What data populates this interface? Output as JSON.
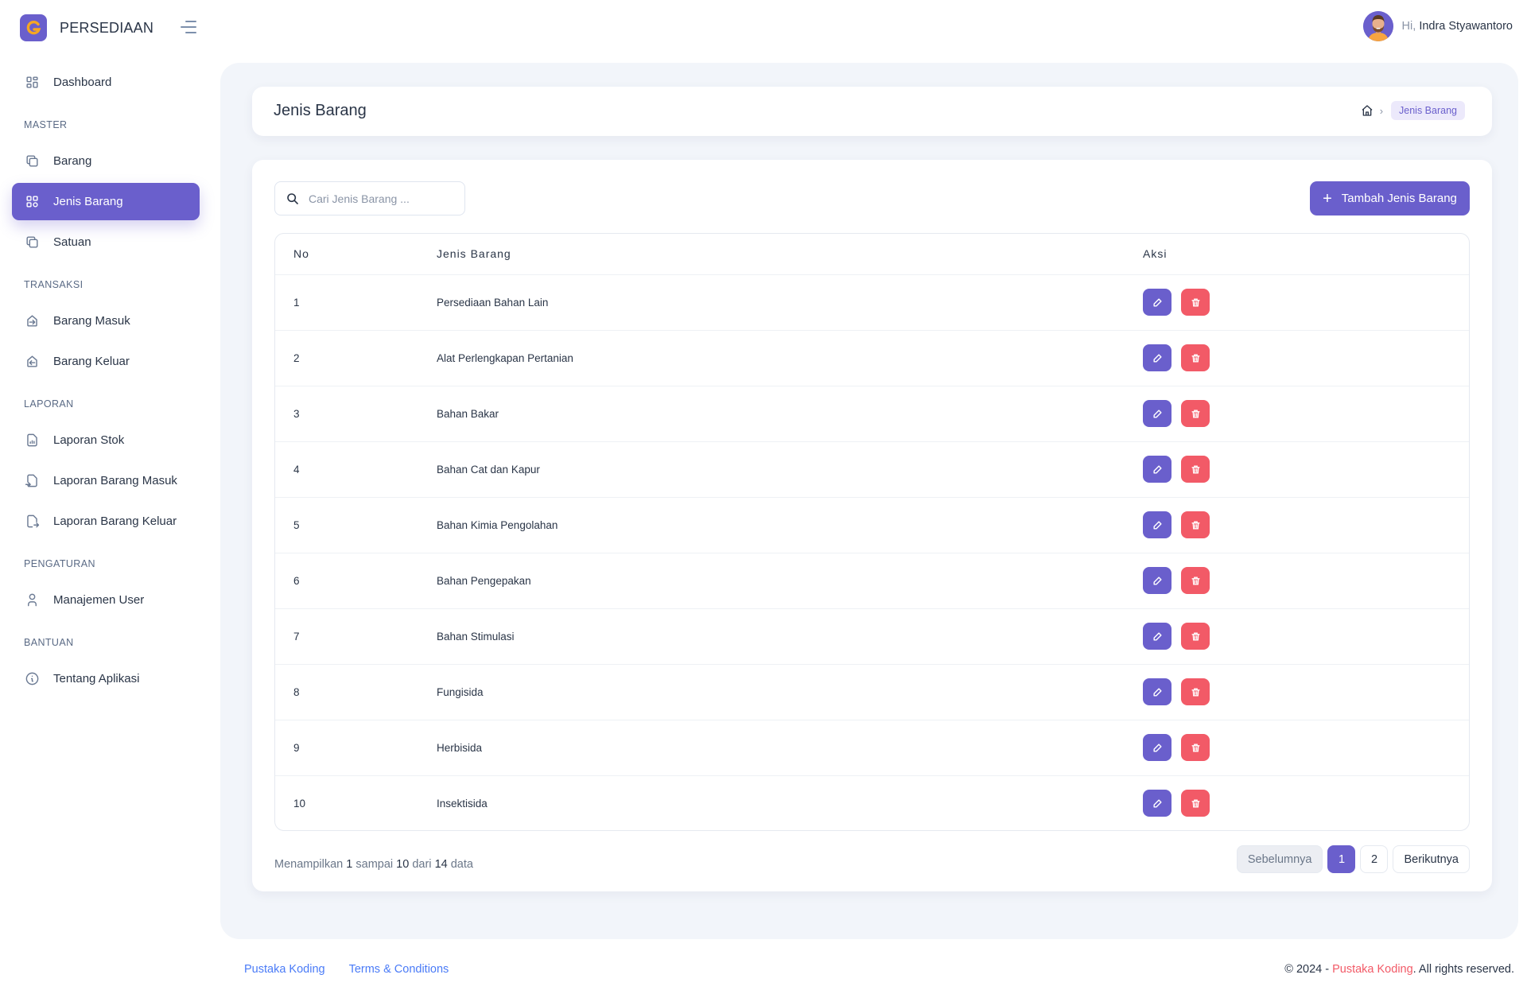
{
  "brand": {
    "logo_letter": "G",
    "name": "PERSEDIAAN",
    "accent": "#6a5fcc",
    "logo_letter_color": "#f5a623"
  },
  "user": {
    "greeting": "Hi,",
    "name": "Indra Styawantoro"
  },
  "sidebar": {
    "items": [
      {
        "type": "item",
        "label": "Dashboard",
        "icon": "dashboard-icon"
      },
      {
        "type": "section",
        "label": "MASTER"
      },
      {
        "type": "item",
        "label": "Barang",
        "icon": "copy-icon"
      },
      {
        "type": "item",
        "label": "Jenis Barang",
        "icon": "category-icon",
        "active": true
      },
      {
        "type": "item",
        "label": "Satuan",
        "icon": "copy-icon"
      },
      {
        "type": "section",
        "label": "TRANSAKSI"
      },
      {
        "type": "item",
        "label": "Barang Masuk",
        "icon": "login-icon"
      },
      {
        "type": "item",
        "label": "Barang Keluar",
        "icon": "logout-icon"
      },
      {
        "type": "section",
        "label": "LAPORAN"
      },
      {
        "type": "item",
        "label": "Laporan Stok",
        "icon": "report-icon"
      },
      {
        "type": "item",
        "label": "Laporan Barang Masuk",
        "icon": "file-import-icon"
      },
      {
        "type": "item",
        "label": "Laporan Barang Keluar",
        "icon": "file-export-icon"
      },
      {
        "type": "section",
        "label": "PENGATURAN"
      },
      {
        "type": "item",
        "label": "Manajemen User",
        "icon": "user-icon"
      },
      {
        "type": "section",
        "label": "BANTUAN"
      },
      {
        "type": "item",
        "label": "Tentang Aplikasi",
        "icon": "info-icon"
      }
    ]
  },
  "header": {
    "title": "Jenis Barang",
    "breadcrumb_active": "Jenis Barang"
  },
  "toolbar": {
    "search_placeholder": "Cari Jenis Barang ...",
    "search_value": "",
    "add_label": "Tambah Jenis Barang"
  },
  "table": {
    "columns": [
      "No",
      "Jenis Barang",
      "Aksi"
    ],
    "rows": [
      {
        "no": "1",
        "name": "Persediaan Bahan Lain"
      },
      {
        "no": "2",
        "name": "Alat Perlengkapan Pertanian"
      },
      {
        "no": "3",
        "name": "Bahan Bakar"
      },
      {
        "no": "4",
        "name": "Bahan Cat dan Kapur"
      },
      {
        "no": "5",
        "name": "Bahan Kimia Pengolahan"
      },
      {
        "no": "6",
        "name": "Bahan Pengepakan"
      },
      {
        "no": "7",
        "name": "Bahan Stimulasi"
      },
      {
        "no": "8",
        "name": "Fungisida"
      },
      {
        "no": "9",
        "name": "Herbisida"
      },
      {
        "no": "10",
        "name": "Insektisida"
      }
    ]
  },
  "info": {
    "prefix": "Menampilkan",
    "from": "1",
    "mid1": "sampai",
    "to": "10",
    "mid2": "dari",
    "total": "14",
    "suffix": "data"
  },
  "pagination": {
    "prev": "Sebelumnya",
    "pages": [
      "1",
      "2"
    ],
    "current": "1",
    "next": "Berikutnya"
  },
  "footer": {
    "links": [
      "Pustaka Koding",
      "Terms & Conditions"
    ],
    "copyright_prefix": "© 2024 -",
    "copyright_link": "Pustaka Koding",
    "copyright_suffix": ". All rights reserved."
  }
}
